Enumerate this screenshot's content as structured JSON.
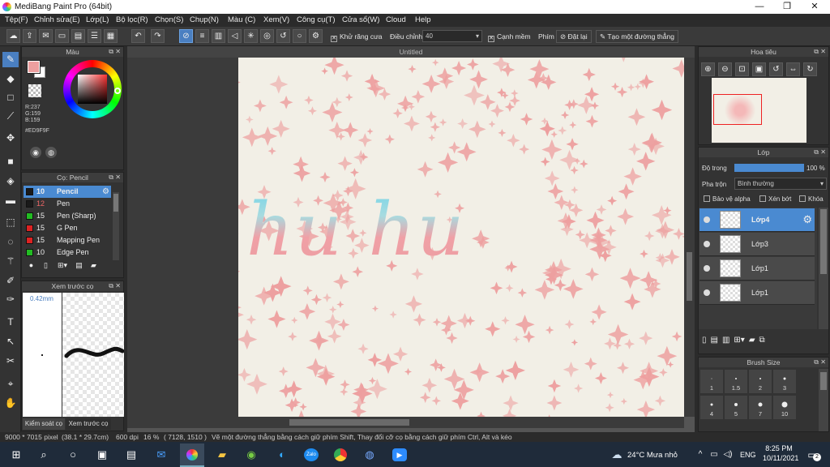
{
  "window": {
    "title": "MediBang Paint Pro (64bit)",
    "minimize": "—",
    "maximize": "❐",
    "close": "✕"
  },
  "menu": [
    "Tệp(F)",
    "Chỉnh sửa(E)",
    "Lớp(L)",
    "Bộ lọc(R)",
    "Chọn(S)",
    "Chụp(N)",
    "Màu (C)",
    "Xem(V)",
    "Công cụ(T)",
    "Cửa sổ(W)",
    "Cloud",
    "Help"
  ],
  "toolbar": {
    "antialias_label": "Khử răng cưa",
    "correction_label": "Điều chỉnh",
    "correction_value": "40",
    "edge_label": "Cạnh mềm",
    "key_label": "Phím",
    "reset_label": "Đặt lại",
    "straight_label": "Tạo một đường thẳng"
  },
  "color_panel": {
    "title": "Màu",
    "r": "R:237",
    "g": "G:159",
    "b": "B:159",
    "hex": "#ED9F9F",
    "fg": "#ED9F9F",
    "bg": "#FFFFFF"
  },
  "brush_panel": {
    "title": "Cọ: Pencil",
    "brushes": [
      {
        "size": "10",
        "name": "Pencil",
        "color": "#1a1a1a"
      },
      {
        "size": "12",
        "name": "Pen",
        "color": "#1a1a1a"
      },
      {
        "size": "15",
        "name": "Pen (Sharp)",
        "color": "#22bb22"
      },
      {
        "size": "15",
        "name": "G Pen",
        "color": "#dd2222"
      },
      {
        "size": "15",
        "name": "Mapping Pen",
        "color": "#dd2222"
      },
      {
        "size": "10",
        "name": "Edge Pen",
        "color": "#22bb22"
      }
    ]
  },
  "preview_panel": {
    "title": "Xem trước cọ",
    "size": "0.42mm",
    "tab1": "Kiểm soát cọ",
    "tab2": "Xem trước cọ"
  },
  "canvas": {
    "tab_title": "Untitled",
    "text": "hu hu"
  },
  "navigator": {
    "title": "Hoa tiêu"
  },
  "layer_panel": {
    "title": "Lớp",
    "opacity_label": "Độ trong",
    "opacity_value": "100 %",
    "opacity": 1.0,
    "blend_label": "Pha trộn",
    "blend_value": "Bình thường",
    "protect_alpha": "Bảo vệ alpha",
    "clipping": "Xén bớt",
    "lock": "Khóa",
    "layers": [
      "Lớp4",
      "Lớp3",
      "Lớp1",
      "Lớp1"
    ]
  },
  "brush_size_panel": {
    "title": "Brush Size",
    "sizes": [
      "1",
      "1.5",
      "2",
      "3",
      "4",
      "5",
      "7",
      "10"
    ]
  },
  "status": {
    "dimensions": "9000 * 7015 pixel",
    "cm": "(38.1 * 29.7cm)",
    "dpi": "600 dpi",
    "zoom": "16 %",
    "coords": "( 7128, 1510 )",
    "hint": "Vẽ một đường thẳng bằng cách giữ phím Shift, Thay đổi cỡ cọ bằng cách giữ phím Ctrl, Alt và kéo"
  },
  "taskbar": {
    "weather": "24°C  Mưa nhỏ",
    "lang": "ENG",
    "time": "8:25 PM",
    "date": "10/11/2021",
    "notif": "2"
  },
  "colors": {
    "accent": "#4a8ad1",
    "pink": "#ED9F9F",
    "cyan": "#7fd6e6"
  }
}
